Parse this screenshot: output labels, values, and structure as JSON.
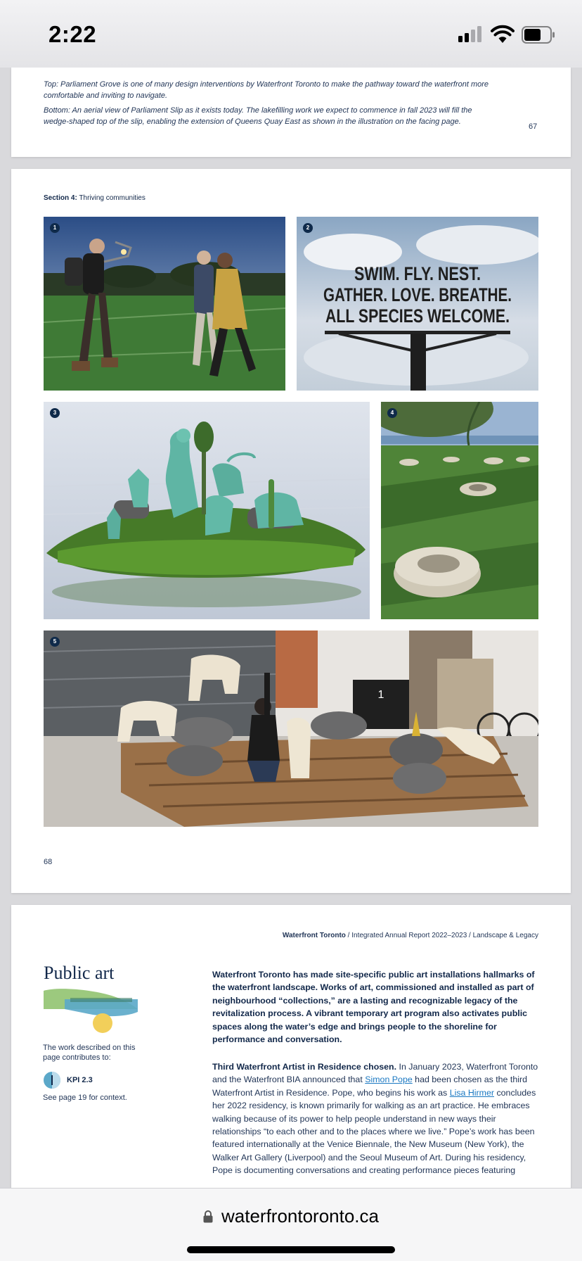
{
  "status_bar": {
    "time": "2:22",
    "signal_bars_active": 2,
    "signal_bars_total": 4
  },
  "page67": {
    "caption_top": "Top: Parliament Grove is one of many design interventions by Waterfront Toronto to make the pathway toward the waterfront more comfortable and inviting to navigate.",
    "caption_bottom": "Bottom: An aerial view of Parliament Slip as it exists today. The lakefilling work we expect to commence in fall 2023 will fill the wedge-shaped top of the slip, enabling the extension of Queens Quay East as shown in the illustration on the facing page.",
    "page_number": "67"
  },
  "page68": {
    "section_bold": "Section 4:",
    "section_text": " Thriving communities",
    "photos": [
      {
        "num": "1",
        "name": "performer-with-camera-rig-photo"
      },
      {
        "num": "2",
        "name": "swim-fly-nest-sign-photo",
        "sign_lines": [
          "SWIM. FLY. NEST.",
          "GATHER. LOVE. BREATHE.",
          "ALL SPECIES WELCOME."
        ]
      },
      {
        "num": "3",
        "name": "green-animal-sculpture-island-photo"
      },
      {
        "num": "4",
        "name": "stone-seats-park-photo"
      },
      {
        "num": "5",
        "name": "sculpture-workshop-photo",
        "crate_label": "1"
      }
    ],
    "page_number": "68"
  },
  "page69": {
    "running_head_bold": "Waterfront Toronto",
    "running_head_rest": " / Integrated Annual Report 2022–2023 / Landscape & Legacy",
    "title": "Public art",
    "contrib_text": "The work described on this page contributes to:",
    "kpi_label": "KPI 2.3",
    "see_page": "See page 19 for context.",
    "lead_paragraph": "Waterfront Toronto has made site-specific public art installations hallmarks of the waterfront landscape. Works of art, commissioned and installed as part of neighbourhood “collections,” are a lasting and recognizable legacy of the revitalization process. A vibrant temporary art program also activates public spaces along the water’s edge and brings people to the shoreline for performance and conversation.",
    "body": {
      "heading": "Third Waterfront Artist in Residence chosen.",
      "t1": " In January 2023, Waterfront Toronto and the Waterfront BIA announced that ",
      "link1": "Simon Pope",
      "t2": " had been chosen as the third Waterfront Artist in Residence. Pope, who begins his work as ",
      "link2": "Lisa Hirmer",
      "t3": " concludes her 2022 residency, is known primarily for walking as an art practice. He embraces walking because of its power to help people understand in new ways their relationships “to each other and to the places where we live.” Pope’s work has been featured internationally at the Venice Biennale, the New Museum (New York), the Walker Art Gallery (Liverpool) and the Seoul Museum of Art. During his residency, Pope is documenting conversations and creating performance pieces featuring"
    },
    "colors": {
      "navy": "#12284a",
      "link": "#1a78c2",
      "green": "#9cc97e",
      "teal": "#5ba8c9",
      "yellow": "#f2cf5a"
    }
  },
  "url_bar": {
    "domain": "waterfrontoronto.ca"
  }
}
